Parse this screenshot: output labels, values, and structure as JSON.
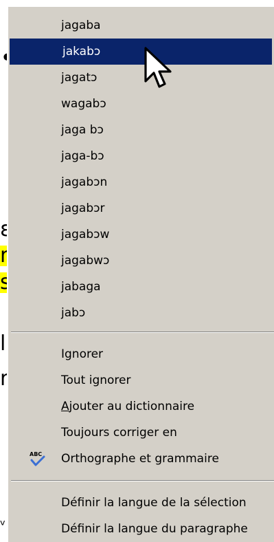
{
  "background": {
    "fragments": [
      "•",
      "ε",
      "n",
      "s",
      "l",
      "n",
      "ᵛ"
    ]
  },
  "menu": {
    "suggestions": [
      "jagaba",
      "jakabɔ",
      "jagatɔ",
      "wagabɔ",
      "jaga bɔ",
      "jaga-bɔ",
      "jagabɔn",
      "jagabɔr",
      "jagabɔw",
      "jagabwɔ",
      "jabaga",
      "jabɔ"
    ],
    "selected_index": 1,
    "actions": {
      "ignore_label": "Ignorer",
      "ignore_all_label": "Tout ignorer",
      "add_dict_prefix": "A",
      "add_dict_rest": "jouter au dictionnaire",
      "autocorrect_label": "Toujours corriger en",
      "spelling_label": "Orthographe et grammaire",
      "set_language_selection": "Définir la langue de la sélection",
      "set_language_paragraph": "Définir la langue du paragraphe"
    },
    "icons": {
      "spelling": "abc-checkmark-icon",
      "cursor": "arrow-cursor-icon"
    },
    "colors": {
      "menu_bg": "#d4d0c8",
      "selection_bg": "#0a246a",
      "highlight": "#ffff00"
    }
  }
}
